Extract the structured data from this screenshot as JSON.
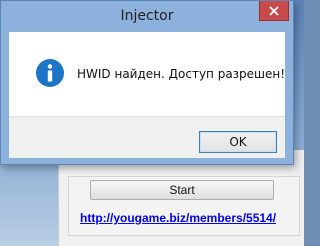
{
  "dialog": {
    "title": "Injector",
    "message": "HWID найден. Доступ разрешен!",
    "ok_label": "OK",
    "icon": "info-icon",
    "accent_color": "#1e75c8"
  },
  "background_app": {
    "start_label": "Start",
    "link_text": "http://yougame.biz/members/5514/"
  }
}
